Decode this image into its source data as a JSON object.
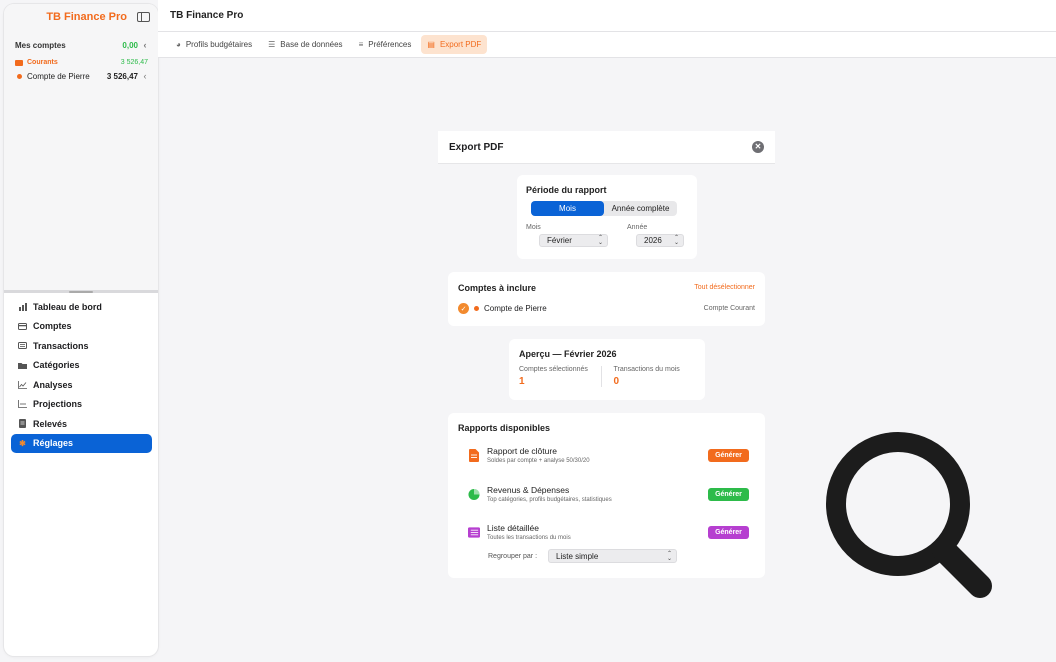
{
  "app": {
    "name": "TB Finance Pro",
    "header_title": "TB Finance Pro"
  },
  "accounts": {
    "title": "Mes comptes",
    "total": "0,00",
    "group": {
      "label": "Courants",
      "amount": "3 526,47"
    },
    "items": [
      {
        "name": "Compte  de Pierre",
        "amount": "3 526,47"
      }
    ]
  },
  "nav": [
    {
      "label": "Tableau de bord",
      "icon": "bar-chart-icon"
    },
    {
      "label": "Comptes",
      "icon": "card-icon"
    },
    {
      "label": "Transactions",
      "icon": "list-icon"
    },
    {
      "label": "Catégories",
      "icon": "folder-icon"
    },
    {
      "label": "Analyses",
      "icon": "line-chart-icon"
    },
    {
      "label": "Projections",
      "icon": "projection-icon"
    },
    {
      "label": "Relevés",
      "icon": "document-icon"
    },
    {
      "label": "Réglages",
      "icon": "gear-icon",
      "active": true
    }
  ],
  "tabs": [
    {
      "label": "Profils budgétaires",
      "icon": "pie-icon"
    },
    {
      "label": "Base de données",
      "icon": "database-icon"
    },
    {
      "label": "Préférences",
      "icon": "sliders-icon"
    },
    {
      "label": "Export PDF",
      "icon": "pdf-icon",
      "active": true
    }
  ],
  "export": {
    "title": "Export PDF",
    "period": {
      "title": "Période du rapport",
      "seg_month": "Mois",
      "seg_year": "Année complète",
      "month_label": "Mois",
      "month_value": "Février",
      "year_label": "Année",
      "year_value": "2026"
    },
    "comptes": {
      "title": "Comptes à inclure",
      "deselect": "Tout désélectionner",
      "account_name": "Compte  de Pierre",
      "account_type": "Compte Courant"
    },
    "apercu": {
      "title": "Aperçu — Février 2026",
      "selected_label": "Comptes sélectionnés",
      "selected_value": "1",
      "tx_label": "Transactions du mois",
      "tx_value": "0"
    },
    "rapports": {
      "title": "Rapports disponibles",
      "items": [
        {
          "title": "Rapport de clôture",
          "subtitle": "Soldes par compte + analyse 50/30/20",
          "button": "Générer",
          "color": "#f26b1d"
        },
        {
          "title": "Revenus & Dépenses",
          "subtitle": "Top catégories, profils budgétaires, statistiques",
          "button": "Générer",
          "color": "#2dbb4a"
        },
        {
          "title": "Liste détaillée",
          "subtitle": "Toutes les transactions du mois",
          "button": "Générer",
          "color": "#b63fd0"
        }
      ],
      "group_by_label": "Regrouper par :",
      "group_by_value": "Liste simple"
    }
  }
}
